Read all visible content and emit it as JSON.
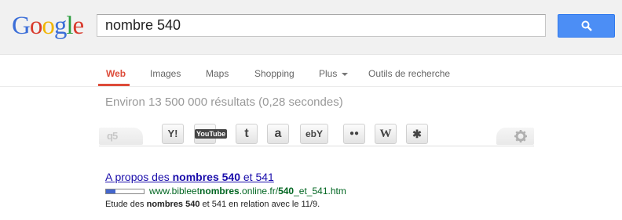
{
  "logo": {
    "letters": [
      "G",
      "o",
      "o",
      "g",
      "l",
      "e"
    ],
    "colors": [
      "#3b6ed8",
      "#d83a2c",
      "#f1b500",
      "#3b6ed8",
      "#2d9e3f",
      "#d83a2c"
    ]
  },
  "search": {
    "query": "nombre 540"
  },
  "nav": {
    "items": [
      {
        "label": "Web"
      },
      {
        "label": "Images"
      },
      {
        "label": "Maps"
      },
      {
        "label": "Shopping"
      },
      {
        "label": "Plus"
      },
      {
        "label": "Outils de recherche"
      }
    ],
    "active_color": "#dd4b39"
  },
  "stats": "Environ 13 500 000 résultats (0,28 secondes)",
  "toolbar": {
    "left_logo": "q5",
    "extensions": [
      "yahoo-icon",
      "youtube-icon",
      "twitter-icon",
      "amazon-icon",
      "ebay-icon",
      "flickr-icon",
      "wikipedia-icon",
      "yelp-icon"
    ],
    "ext_labels": [
      "Y!",
      "YouTube",
      "t",
      "a",
      "ebY",
      "●●",
      "W",
      "✱"
    ]
  },
  "result": {
    "title_1": "A propos des ",
    "title_2": "nombres 540",
    "title_3": " et 541",
    "pagerank": 0.25,
    "url_1": "www.bibleet",
    "url_2": "nombres",
    "url_3": ".online.fr/",
    "url_4": "540",
    "url_5": "_et_541.htm",
    "snippet_1": "Etude des ",
    "snippet_2": "nombres 540",
    "snippet_3": " et 541 en relation avec le 11/9."
  }
}
